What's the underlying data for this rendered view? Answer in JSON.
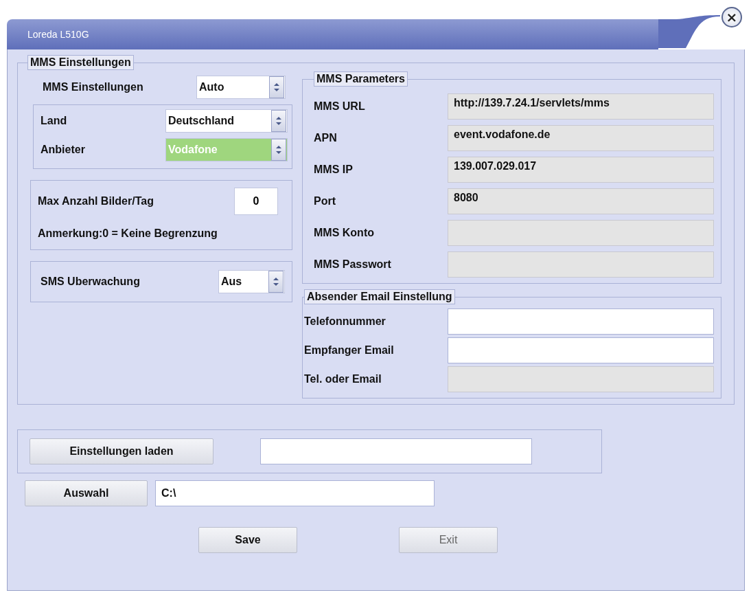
{
  "window": {
    "title": "Loreda L510G",
    "close": "×"
  },
  "mms_settings": {
    "legend": "MMS Einstellungen",
    "mode": {
      "label": "MMS Einstellungen",
      "value": "Auto",
      "highlighted": false
    },
    "country": {
      "label": "Land",
      "value": "Deutschland",
      "highlighted": false
    },
    "provider": {
      "label": "Anbieter",
      "value": "Vodafone",
      "highlighted": true
    },
    "max_pictures": {
      "label": "Max Anzahl Bilder/Tag",
      "value": "0",
      "note": "Anmerkung:0 = Keine Begrenzung"
    },
    "sms_monitoring": {
      "label": "SMS Uberwachung",
      "value": "Aus",
      "highlighted": false
    }
  },
  "mms_parameters": {
    "legend": "MMS Parameters",
    "fields": [
      {
        "label": "MMS URL",
        "value": "http://139.7.24.1/servlets/mms",
        "disabled": true
      },
      {
        "label": "APN",
        "value": "event.vodafone.de",
        "disabled": true
      },
      {
        "label": "MMS IP",
        "value": "139.007.029.017",
        "disabled": true
      },
      {
        "label": "Port",
        "value": "8080",
        "disabled": true
      },
      {
        "label": "MMS Konto",
        "disabled": true
      },
      {
        "label": "MMS Passwort",
        "disabled": true
      }
    ]
  },
  "sender_email": {
    "legend": "Absender Email Einstellung",
    "fields": [
      {
        "label": "Telefonnummer",
        "disabled": false
      },
      {
        "label": "Empfanger Email",
        "disabled": false
      },
      {
        "label": "Tel. oder Email",
        "disabled": true
      }
    ]
  },
  "load": {
    "button": "Einstellungen laden"
  },
  "browse": {
    "button": "Auswahl",
    "value": "C:\\"
  },
  "buttons": [
    {
      "label": "Save",
      "disabled": false
    },
    {
      "label": "Exit",
      "disabled": true
    }
  ]
}
